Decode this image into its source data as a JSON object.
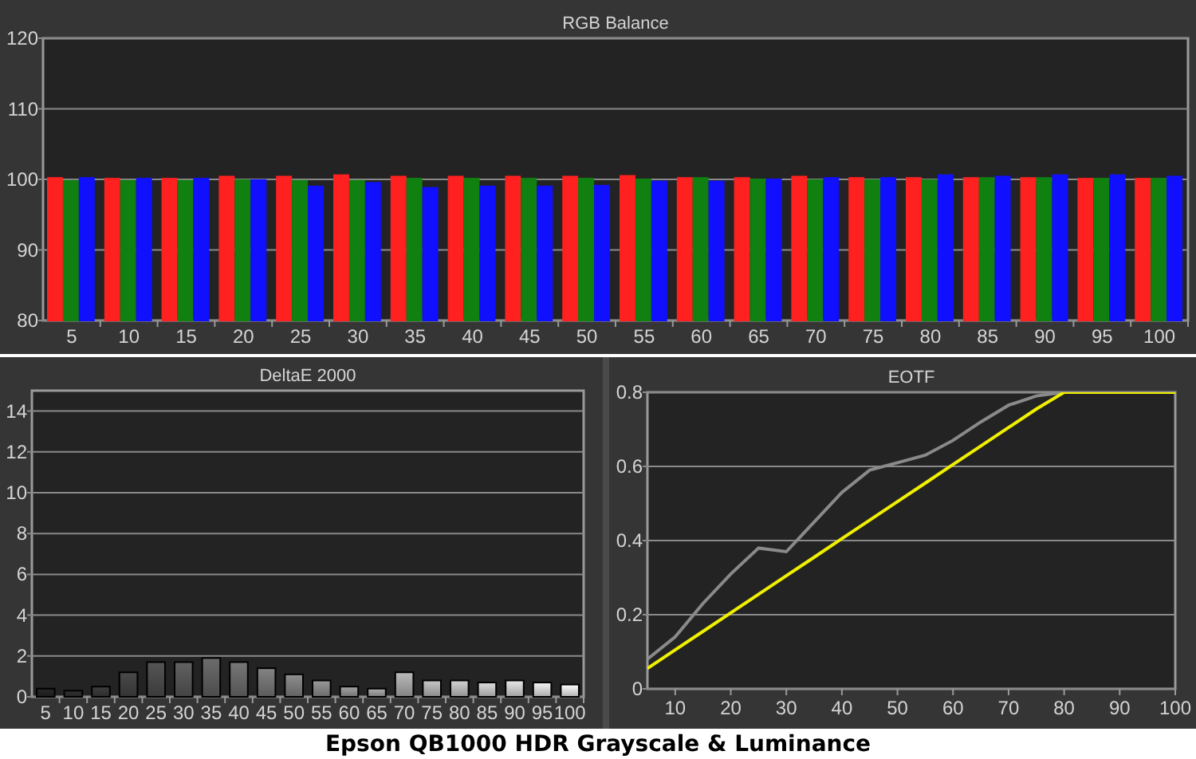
{
  "charts": [
    {
      "chart_data": {
        "type": "bar",
        "title": "RGB Balance",
        "grid": true,
        "categories": [
          "5",
          "10",
          "15",
          "20",
          "25",
          "30",
          "35",
          "40",
          "45",
          "50",
          "55",
          "60",
          "65",
          "70",
          "75",
          "80",
          "85",
          "90",
          "95",
          "100"
        ],
        "ylim": [
          80,
          120
        ],
        "yticks": [
          80,
          90,
          100,
          110,
          120
        ],
        "series": [
          {
            "color": "#ff2020",
            "values": [
              100.2,
              100.1,
              100.1,
              100.4,
              100.4,
              100.6,
              100.4,
              100.4,
              100.4,
              100.4,
              100.5,
              100.2,
              100.2,
              100.4,
              100.2,
              100.2,
              100.2,
              100.2,
              100.1,
              100.1
            ]
          },
          {
            "color": "#108010",
            "values": [
              99.8,
              99.8,
              99.8,
              99.9,
              99.8,
              99.8,
              100.1,
              100.1,
              100.1,
              100.1,
              100.0,
              100.2,
              100.0,
              99.9,
              99.9,
              99.9,
              100.2,
              100.2,
              100.1,
              100.1
            ]
          },
          {
            "color": "#1010ff",
            "values": [
              100.2,
              100.1,
              100.1,
              99.9,
              99.0,
              99.5,
              98.8,
              99.0,
              99.0,
              99.1,
              99.7,
              99.7,
              100.0,
              100.2,
              100.2,
              100.6,
              100.4,
              100.6,
              100.6,
              100.4
            ]
          }
        ]
      }
    },
    {
      "chart_data": {
        "type": "bar",
        "title": "DeltaE 2000",
        "grid": true,
        "categories": [
          "5",
          "10",
          "15",
          "20",
          "25",
          "30",
          "35",
          "40",
          "45",
          "50",
          "55",
          "60",
          "65",
          "70",
          "75",
          "80",
          "85",
          "90",
          "95",
          "100"
        ],
        "ylim": [
          0,
          15
        ],
        "yticks": [
          0,
          2,
          4,
          6,
          8,
          10,
          12,
          14
        ],
        "values": [
          0.4,
          0.3,
          0.5,
          1.2,
          1.7,
          1.7,
          1.9,
          1.7,
          1.4,
          1.1,
          0.8,
          0.5,
          0.4,
          1.2,
          0.8,
          0.8,
          0.7,
          0.8,
          0.7,
          0.6
        ]
      }
    },
    {
      "chart_data": {
        "type": "line",
        "title": "EOTF",
        "grid": true,
        "x": [
          5,
          10,
          15,
          20,
          25,
          30,
          35,
          40,
          45,
          50,
          55,
          60,
          65,
          70,
          75,
          80,
          85,
          90,
          95,
          100
        ],
        "xlim": [
          5,
          100
        ],
        "ylim": [
          0,
          0.8
        ],
        "xticks": [
          10,
          20,
          30,
          40,
          50,
          60,
          70,
          80,
          90,
          100
        ],
        "yticks": [
          0,
          0.2,
          0.4,
          0.6,
          0.8
        ],
        "series": [
          {
            "color": "#8a8a8a",
            "values": [
              0.08,
              0.14,
              0.23,
              0.31,
              0.38,
              0.37,
              0.45,
              0.53,
              0.59,
              0.61,
              0.63,
              0.67,
              0.72,
              0.765,
              0.79,
              0.8,
              0.8,
              0.8,
              0.8,
              0.8
            ]
          },
          {
            "color": "#f0f000",
            "values": [
              0.055,
              0.105,
              0.155,
              0.205,
              0.255,
              0.305,
              0.355,
              0.405,
              0.455,
              0.505,
              0.555,
              0.605,
              0.655,
              0.705,
              0.755,
              0.8,
              0.8,
              0.8,
              0.8,
              0.8
            ]
          }
        ]
      }
    }
  ],
  "caption": "Epson QB1000 HDR Grayscale & Luminance"
}
